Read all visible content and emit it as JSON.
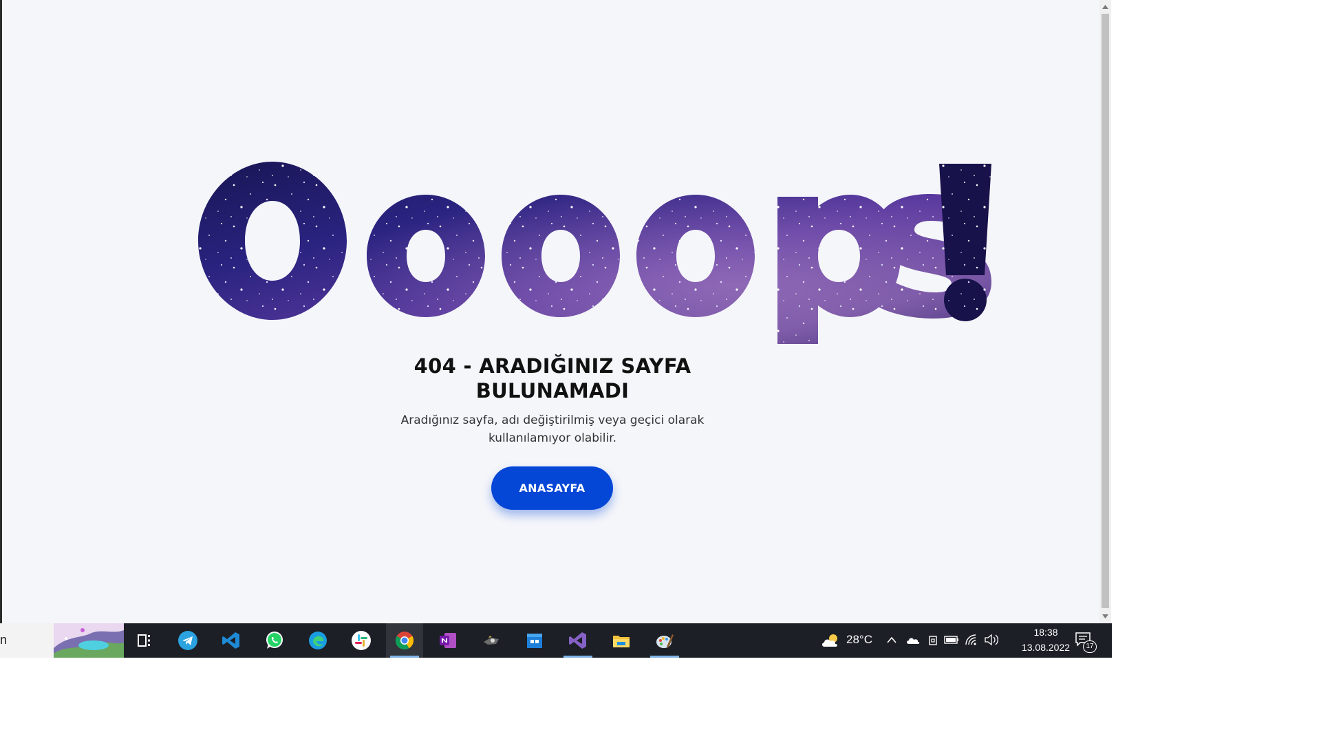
{
  "page": {
    "hero_word": "Ooops!",
    "title": "404 - ARADIĞINIZ SAYFA BULUNAMADI",
    "description": "Aradığınız sayfa, adı değiştirilmiş veya geçici olarak kullanılamıyor olabilir.",
    "home_button_label": "ANASAYFA"
  },
  "taskbar": {
    "search_text": "n",
    "apps": [
      {
        "icon": "task-view-icon",
        "active": false
      },
      {
        "icon": "telegram-icon",
        "active": false
      },
      {
        "icon": "vscode-icon",
        "active": false
      },
      {
        "icon": "whatsapp-icon",
        "active": false
      },
      {
        "icon": "edge-icon",
        "active": false
      },
      {
        "icon": "slack-icon",
        "active": false
      },
      {
        "icon": "chrome-icon",
        "active": true
      },
      {
        "icon": "onenote-icon",
        "active": false
      },
      {
        "icon": "camera-app-icon",
        "active": false
      },
      {
        "icon": "windows-store-icon",
        "active": false
      },
      {
        "icon": "visual-studio-icon",
        "active": true
      },
      {
        "icon": "file-explorer-icon",
        "active": false
      },
      {
        "icon": "paint-icon",
        "active": true
      }
    ]
  },
  "tray": {
    "weather_temp": "28°C",
    "time": "18:38",
    "date": "13.08.2022",
    "notification_count": "17"
  },
  "colors": {
    "page_background": "#f5f6fa",
    "button": "#0446d6",
    "taskbar": "#1c1f26",
    "galaxy_dark": "#1a1650",
    "galaxy_purple": "#5a3aa8"
  }
}
